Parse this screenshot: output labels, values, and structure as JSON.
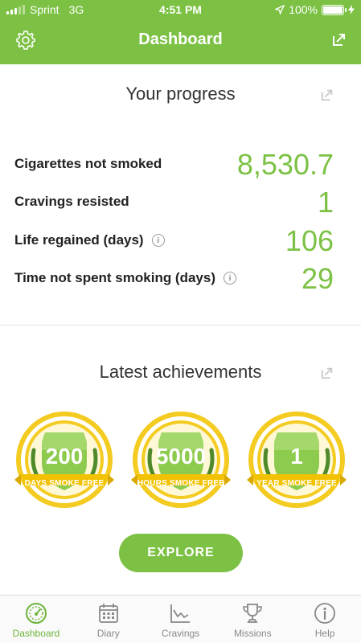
{
  "status": {
    "carrier": "Sprint",
    "network": "3G",
    "time": "4:51 PM",
    "battery": "100%"
  },
  "header": {
    "title": "Dashboard",
    "settings_icon": "gear-icon",
    "export_icon": "export-icon"
  },
  "progress": {
    "title": "Your progress",
    "stats": [
      {
        "label": "Cigarettes not smoked",
        "value": "8,530.7",
        "info": false
      },
      {
        "label": "Cravings resisted",
        "value": "1",
        "info": false
      },
      {
        "label": "Life regained (days)",
        "value": "106",
        "info": true
      },
      {
        "label": "Time not spent smoking (days)",
        "value": "29",
        "info": true
      }
    ]
  },
  "achievements": {
    "title": "Latest achievements",
    "badges": [
      {
        "value": "200",
        "caption": "DAYS SMOKE FREE"
      },
      {
        "value": "5000",
        "caption": "HOURS SMOKE FREE"
      },
      {
        "value": "1",
        "caption": "YEAR SMOKE FREE"
      }
    ],
    "button": "EXPLORE"
  },
  "tabs": [
    {
      "label": "Dashboard",
      "icon": "speedometer-icon",
      "active": true
    },
    {
      "label": "Diary",
      "icon": "calendar-icon",
      "active": false
    },
    {
      "label": "Cravings",
      "icon": "chart-icon",
      "active": false
    },
    {
      "label": "Missions",
      "icon": "trophy-icon",
      "active": false
    },
    {
      "label": "Help",
      "icon": "info-icon",
      "active": false
    }
  ],
  "colors": {
    "brand": "#7cc144",
    "badge_gold": "#f2c200",
    "badge_green": "#8dcb4e"
  }
}
